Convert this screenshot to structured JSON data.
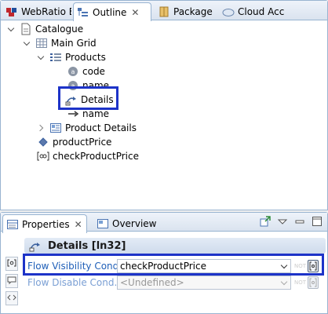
{
  "outline": {
    "tabs": [
      {
        "label": "WebRatio E",
        "icon": "webratio-icon"
      },
      {
        "label": "Outline",
        "icon": "outline-icon",
        "close": "✕"
      },
      {
        "label": "Package E",
        "icon": "package-icon"
      },
      {
        "label": "Cloud Acc",
        "icon": "cloud-icon"
      }
    ],
    "tree": [
      {
        "label": "Catalogue",
        "icon": "page-icon",
        "twisty": "down"
      },
      {
        "label": "Main Grid",
        "icon": "grid-icon",
        "twisty": "down"
      },
      {
        "label": "Products",
        "icon": "list-icon",
        "twisty": "down"
      },
      {
        "label": "code",
        "icon": "attribute-icon"
      },
      {
        "label": "name",
        "icon": "attribute-icon"
      },
      {
        "label": "Details",
        "icon": "flow-icon"
      },
      {
        "label": "name",
        "icon": "arrow-icon"
      },
      {
        "label": "Product Details",
        "icon": "details-icon",
        "twisty": "right"
      },
      {
        "label": "productPrice",
        "icon": "diamond-icon"
      },
      {
        "label": "checkProductPrice",
        "icon": "expression-icon"
      }
    ]
  },
  "properties": {
    "tabs": [
      {
        "label": "Properties",
        "icon": "properties-icon",
        "close": "✕"
      },
      {
        "label": "Overview",
        "icon": "overview-icon"
      }
    ],
    "title": "Details [ln32]",
    "rows": [
      {
        "label": "Flow Visibility Cond.",
        "value": "checkProductPrice",
        "not": "NOT"
      },
      {
        "label": "Flow Disable Cond.",
        "value": "<Undefined>",
        "not": "NOT"
      }
    ]
  },
  "colors": {
    "highlight": "#1d33c8",
    "link_label": "#1f5fb8",
    "tab_border": "#99b4d1"
  }
}
